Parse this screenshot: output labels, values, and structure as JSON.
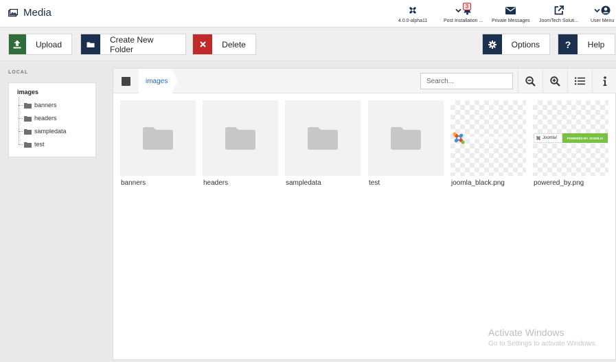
{
  "header": {
    "title": "Media",
    "items": [
      {
        "label": "4.0.0-alpha11",
        "icon": "joomla-icon"
      },
      {
        "label": "Post Installation ...",
        "icon": "bell-icon",
        "badge": "3"
      },
      {
        "label": "Private Messages",
        "icon": "envelope-icon"
      },
      {
        "label": "JoomTech Soluti...",
        "icon": "external-link-icon"
      },
      {
        "label": "User Menu",
        "icon": "user-icon"
      }
    ]
  },
  "toolbar": {
    "upload": "Upload",
    "new_folder": "Create New Folder",
    "delete": "Delete",
    "options": "Options",
    "help": "Help"
  },
  "colors": {
    "upload": "#2f6e3b",
    "navy": "#1b2f4f",
    "delete": "#c02a2a"
  },
  "sidebar": {
    "section_label": "LOCAL",
    "root": "images",
    "folders": [
      "banners",
      "headers",
      "sampledata",
      "test"
    ]
  },
  "browser": {
    "breadcrumb": "images",
    "search_placeholder": "Search...",
    "items": [
      {
        "name": "banners",
        "type": "folder"
      },
      {
        "name": "headers",
        "type": "folder"
      },
      {
        "name": "sampledata",
        "type": "folder"
      },
      {
        "name": "test",
        "type": "folder"
      },
      {
        "name": "joomla_black.png",
        "type": "image"
      },
      {
        "name": "powered_by.png",
        "type": "image"
      }
    ],
    "powered_text": "POWERED BY JOOMLA!",
    "logo_text": "Joomla!"
  },
  "watermark": {
    "line1": "Activate Windows",
    "line2": "Go to Settings to activate Windows."
  }
}
